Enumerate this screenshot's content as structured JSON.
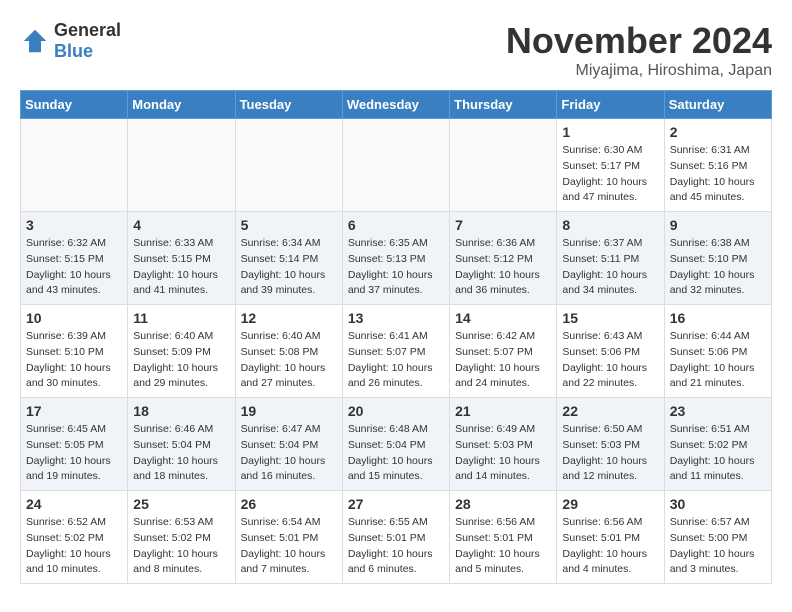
{
  "header": {
    "logo_general": "General",
    "logo_blue": "Blue",
    "month": "November 2024",
    "location": "Miyajima, Hiroshima, Japan"
  },
  "days_of_week": [
    "Sunday",
    "Monday",
    "Tuesday",
    "Wednesday",
    "Thursday",
    "Friday",
    "Saturday"
  ],
  "weeks": [
    [
      {
        "day": "",
        "info": ""
      },
      {
        "day": "",
        "info": ""
      },
      {
        "day": "",
        "info": ""
      },
      {
        "day": "",
        "info": ""
      },
      {
        "day": "",
        "info": ""
      },
      {
        "day": "1",
        "info": "Sunrise: 6:30 AM\nSunset: 5:17 PM\nDaylight: 10 hours\nand 47 minutes."
      },
      {
        "day": "2",
        "info": "Sunrise: 6:31 AM\nSunset: 5:16 PM\nDaylight: 10 hours\nand 45 minutes."
      }
    ],
    [
      {
        "day": "3",
        "info": "Sunrise: 6:32 AM\nSunset: 5:15 PM\nDaylight: 10 hours\nand 43 minutes."
      },
      {
        "day": "4",
        "info": "Sunrise: 6:33 AM\nSunset: 5:15 PM\nDaylight: 10 hours\nand 41 minutes."
      },
      {
        "day": "5",
        "info": "Sunrise: 6:34 AM\nSunset: 5:14 PM\nDaylight: 10 hours\nand 39 minutes."
      },
      {
        "day": "6",
        "info": "Sunrise: 6:35 AM\nSunset: 5:13 PM\nDaylight: 10 hours\nand 37 minutes."
      },
      {
        "day": "7",
        "info": "Sunrise: 6:36 AM\nSunset: 5:12 PM\nDaylight: 10 hours\nand 36 minutes."
      },
      {
        "day": "8",
        "info": "Sunrise: 6:37 AM\nSunset: 5:11 PM\nDaylight: 10 hours\nand 34 minutes."
      },
      {
        "day": "9",
        "info": "Sunrise: 6:38 AM\nSunset: 5:10 PM\nDaylight: 10 hours\nand 32 minutes."
      }
    ],
    [
      {
        "day": "10",
        "info": "Sunrise: 6:39 AM\nSunset: 5:10 PM\nDaylight: 10 hours\nand 30 minutes."
      },
      {
        "day": "11",
        "info": "Sunrise: 6:40 AM\nSunset: 5:09 PM\nDaylight: 10 hours\nand 29 minutes."
      },
      {
        "day": "12",
        "info": "Sunrise: 6:40 AM\nSunset: 5:08 PM\nDaylight: 10 hours\nand 27 minutes."
      },
      {
        "day": "13",
        "info": "Sunrise: 6:41 AM\nSunset: 5:07 PM\nDaylight: 10 hours\nand 26 minutes."
      },
      {
        "day": "14",
        "info": "Sunrise: 6:42 AM\nSunset: 5:07 PM\nDaylight: 10 hours\nand 24 minutes."
      },
      {
        "day": "15",
        "info": "Sunrise: 6:43 AM\nSunset: 5:06 PM\nDaylight: 10 hours\nand 22 minutes."
      },
      {
        "day": "16",
        "info": "Sunrise: 6:44 AM\nSunset: 5:06 PM\nDaylight: 10 hours\nand 21 minutes."
      }
    ],
    [
      {
        "day": "17",
        "info": "Sunrise: 6:45 AM\nSunset: 5:05 PM\nDaylight: 10 hours\nand 19 minutes."
      },
      {
        "day": "18",
        "info": "Sunrise: 6:46 AM\nSunset: 5:04 PM\nDaylight: 10 hours\nand 18 minutes."
      },
      {
        "day": "19",
        "info": "Sunrise: 6:47 AM\nSunset: 5:04 PM\nDaylight: 10 hours\nand 16 minutes."
      },
      {
        "day": "20",
        "info": "Sunrise: 6:48 AM\nSunset: 5:04 PM\nDaylight: 10 hours\nand 15 minutes."
      },
      {
        "day": "21",
        "info": "Sunrise: 6:49 AM\nSunset: 5:03 PM\nDaylight: 10 hours\nand 14 minutes."
      },
      {
        "day": "22",
        "info": "Sunrise: 6:50 AM\nSunset: 5:03 PM\nDaylight: 10 hours\nand 12 minutes."
      },
      {
        "day": "23",
        "info": "Sunrise: 6:51 AM\nSunset: 5:02 PM\nDaylight: 10 hours\nand 11 minutes."
      }
    ],
    [
      {
        "day": "24",
        "info": "Sunrise: 6:52 AM\nSunset: 5:02 PM\nDaylight: 10 hours\nand 10 minutes."
      },
      {
        "day": "25",
        "info": "Sunrise: 6:53 AM\nSunset: 5:02 PM\nDaylight: 10 hours\nand 8 minutes."
      },
      {
        "day": "26",
        "info": "Sunrise: 6:54 AM\nSunset: 5:01 PM\nDaylight: 10 hours\nand 7 minutes."
      },
      {
        "day": "27",
        "info": "Sunrise: 6:55 AM\nSunset: 5:01 PM\nDaylight: 10 hours\nand 6 minutes."
      },
      {
        "day": "28",
        "info": "Sunrise: 6:56 AM\nSunset: 5:01 PM\nDaylight: 10 hours\nand 5 minutes."
      },
      {
        "day": "29",
        "info": "Sunrise: 6:56 AM\nSunset: 5:01 PM\nDaylight: 10 hours\nand 4 minutes."
      },
      {
        "day": "30",
        "info": "Sunrise: 6:57 AM\nSunset: 5:00 PM\nDaylight: 10 hours\nand 3 minutes."
      }
    ]
  ]
}
